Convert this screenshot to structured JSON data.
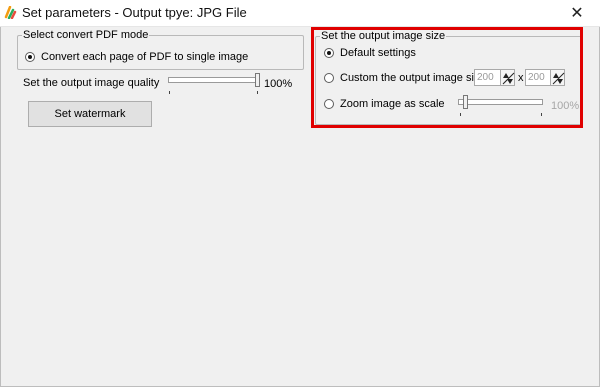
{
  "window": {
    "title": "Set parameters - Output tpye: JPG File",
    "close_glyph": "✕",
    "icon": "app-logo-icon"
  },
  "convert_mode": {
    "legend": "Select convert PDF mode",
    "option_label": "Convert each page of PDF to single image",
    "selected": true
  },
  "quality": {
    "label": "Set the output image quality",
    "value_text": "100%",
    "value": 100
  },
  "watermark_button": "Set watermark",
  "output_size": {
    "legend": "Set the output image size",
    "default_label": "Default settings",
    "custom_label": "Custom the output image size",
    "width_value": "200",
    "times": "x",
    "height_value": "200",
    "zoom_label": "Zoom image as scale",
    "zoom_value_text": "100%",
    "zoom_fraction": 0.08,
    "selected": "default"
  },
  "colors": {
    "highlight": "#e00000",
    "background": "#f0f0f0"
  }
}
